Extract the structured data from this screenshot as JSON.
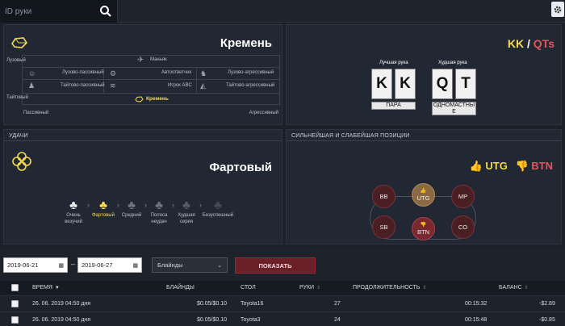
{
  "search": {
    "placeholder": "ID руки"
  },
  "profile": {
    "title": "Кремень",
    "rows": [
      {
        "label": "Лузово-пассивный"
      },
      {
        "label": "Автоответчик"
      },
      {
        "label": "Лузово-агрессивный"
      },
      {
        "label": "Тайтово-пассивный"
      },
      {
        "label": "Игрок ABC"
      },
      {
        "label": "Тайтово-агрессивный"
      }
    ],
    "top_label": "Маньяк",
    "selected_label": "Кремень",
    "axis_loose": "Лузовый",
    "axis_tight": "Тайтовый",
    "axis_passive": "Пассивный",
    "axis_aggressive": "Агрессивный"
  },
  "hands": {
    "title_kk": "KK",
    "title_sep": "/",
    "title_qts": "QTs",
    "best_label": "Лучшая рука",
    "worst_label": "Худшая рука",
    "best_cards": [
      "K",
      "K"
    ],
    "worst_cards": [
      "Q",
      "T"
    ],
    "best_type": "ПАРА",
    "worst_type": "ОДНОМАСТНЫЕ"
  },
  "luck": {
    "header": "УДАЧИ",
    "title": "Фартовый",
    "levels": [
      {
        "label": "Очень везучий"
      },
      {
        "label": "Фартовый"
      },
      {
        "label": "Средний"
      },
      {
        "label": "Полоса неудач"
      },
      {
        "label": "Худшая серия"
      },
      {
        "label": "Безуспешный"
      }
    ]
  },
  "positions": {
    "header": "СИЛЬНЕЙШАЯ И СЛАБЕЙШАЯ ПОЗИЦИИ",
    "best": "UTG",
    "worst": "BTN",
    "seats": [
      "BB",
      "UTG",
      "MP",
      "SB",
      "BTN",
      "CO"
    ]
  },
  "filters": {
    "date_from": "2019-06-21",
    "date_sep": "–",
    "date_to": "2019-06-27",
    "limit": "Блайнды",
    "show": "ПОКАЗАТЬ"
  },
  "table": {
    "headers": [
      "ВРЕМЯ",
      "БЛАЙНДЫ",
      "СТОЛ",
      "РУКИ",
      "ПРОДОЛЖИТЕЛЬНОСТЬ",
      "БАЛАНС"
    ],
    "rows": [
      {
        "time": "26. 06. 2019 04:50 дня",
        "blinds": "$0.05/$0.10",
        "table": "Toyota16",
        "hands": "27",
        "duration": "00:15:32",
        "balance": "-$2.89"
      },
      {
        "time": "26. 06. 2019 04:50 дня",
        "blinds": "$0.05/$0.10",
        "table": "Toyota3",
        "hands": "24",
        "duration": "00:15:48",
        "balance": "-$0.85"
      }
    ]
  },
  "colors": {
    "accent_yellow": "#f2d94e",
    "accent_red": "#e0555f",
    "button": "#6b1f27"
  }
}
